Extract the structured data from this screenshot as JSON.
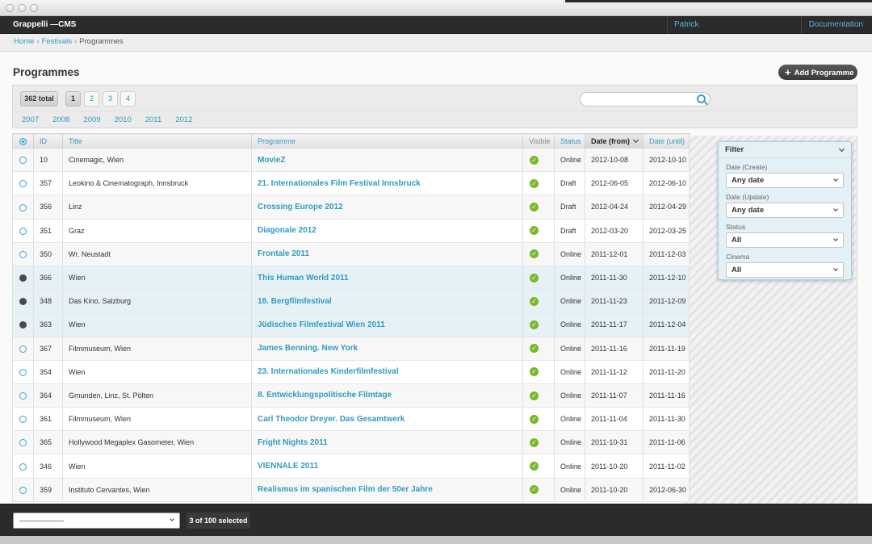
{
  "app": {
    "brand": "Grappelli —CMS",
    "user": "Patrick",
    "documentation": "Documentation"
  },
  "breadcrumb": {
    "home": "Home",
    "festivals": "Festivals",
    "current": "Programmes"
  },
  "page": {
    "title": "Programmes",
    "add_button": "Add Programme"
  },
  "toolbar": {
    "total": "362 total",
    "pages": [
      "1",
      "2",
      "3",
      "4"
    ],
    "current_page": "1",
    "search_placeholder": ""
  },
  "years": [
    "2007",
    "2008",
    "2009",
    "2010",
    "2011",
    "2012"
  ],
  "table": {
    "columns": [
      "ID",
      "Title",
      "Programme",
      "Visible",
      "Status",
      "Date (from)",
      "Date (until)"
    ],
    "sorted_column": "Date (from)",
    "rows": [
      {
        "id": "10",
        "title": "Cinemagic, Wien",
        "programme": "MovieZ",
        "status": "Online",
        "from": "2012-10-08",
        "until": "2012-10-10",
        "selected": false
      },
      {
        "id": "357",
        "title": "Leokino & Cinematograph, Innsbruck",
        "programme": "21. Internationales Film Festival Innsbruck",
        "status": "Draft",
        "from": "2012-06-05",
        "until": "2012-06-10",
        "selected": false
      },
      {
        "id": "356",
        "title": "Linz",
        "programme": "Crossing Europe 2012",
        "status": "Draft",
        "from": "2012-04-24",
        "until": "2012-04-29",
        "selected": false
      },
      {
        "id": "351",
        "title": "Graz",
        "programme": "Diagonale 2012",
        "status": "Draft",
        "from": "2012-03-20",
        "until": "2012-03-25",
        "selected": false
      },
      {
        "id": "350",
        "title": "Wr. Neustadt",
        "programme": "Frontale 2011",
        "status": "Online",
        "from": "2011-12-01",
        "until": "2011-12-03",
        "selected": false
      },
      {
        "id": "366",
        "title": "Wien",
        "programme": "This Human World 2011",
        "status": "Online",
        "from": "2011-11-30",
        "until": "2011-12-10",
        "selected": true
      },
      {
        "id": "348",
        "title": "Das Kino, Salzburg",
        "programme": "18. Bergfilmfestival",
        "status": "Online",
        "from": "2011-11-23",
        "until": "2011-12-09",
        "selected": true
      },
      {
        "id": "363",
        "title": "Wien",
        "programme": "Jüdisches Filmfestival Wien 2011",
        "status": "Online",
        "from": "2011-11-17",
        "until": "2011-12-04",
        "selected": true
      },
      {
        "id": "367",
        "title": "Filmmuseum, Wien",
        "programme": "James Benning. New York",
        "status": "Online",
        "from": "2011-11-16",
        "until": "2011-11-19",
        "selected": false
      },
      {
        "id": "354",
        "title": "Wien",
        "programme": "23. Internationales Kinderfilmfestival",
        "status": "Online",
        "from": "2011-11-12",
        "until": "2011-11-20",
        "selected": false
      },
      {
        "id": "364",
        "title": "Gmunden, Linz, St. Pölten",
        "programme": "8. Entwicklungspolitische Filmtage",
        "status": "Online",
        "from": "2011-11-07",
        "until": "2011-11-16",
        "selected": false
      },
      {
        "id": "361",
        "title": "Filmmuseum, Wien",
        "programme": "Carl Theodor Dreyer. Das Gesamtwerk",
        "status": "Online",
        "from": "2011-11-04",
        "until": "2011-11-30",
        "selected": false
      },
      {
        "id": "365",
        "title": "Hollywood Megaplex Gasometer, Wien",
        "programme": "Fright Nights 2011",
        "status": "Online",
        "from": "2011-10-31",
        "until": "2011-11-06",
        "selected": false
      },
      {
        "id": "346",
        "title": "Wien",
        "programme": "VIENNALE 2011",
        "status": "Online",
        "from": "2011-10-20",
        "until": "2011-11-02",
        "selected": false
      },
      {
        "id": "359",
        "title": "Instituto Cervantes, Wien",
        "programme": "Realismus im spanischen Film der 50er Jahre",
        "status": "Online",
        "from": "2011-10-20",
        "until": "2012-06-30",
        "selected": false
      }
    ]
  },
  "filter": {
    "title": "Filter",
    "fields": [
      {
        "label": "Date (Create)",
        "value": "Any date"
      },
      {
        "label": "Date (Update)",
        "value": "Any date"
      },
      {
        "label": "Status",
        "value": "All"
      },
      {
        "label": "Cinema",
        "value": "All"
      }
    ]
  },
  "footer": {
    "action_value": "",
    "selected_count": "3 of 100 selected"
  },
  "colors": {
    "accent": "#309bbf",
    "topbar": "#2b2b2b",
    "visible_check": "#7ab829",
    "selected_row": "#e6f1f6"
  }
}
